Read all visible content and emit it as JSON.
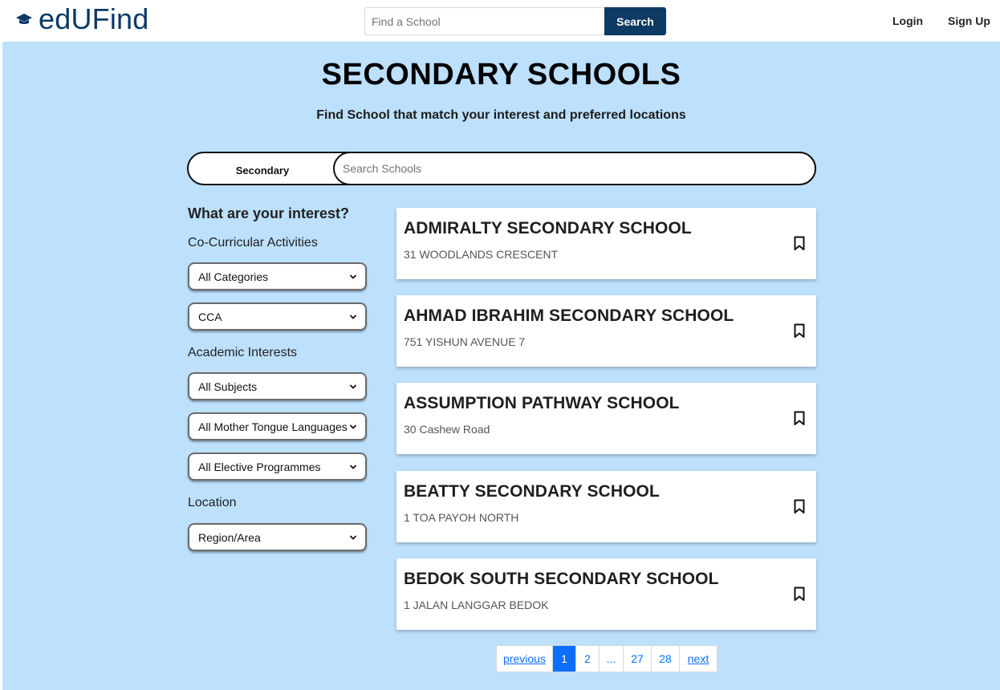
{
  "brand": {
    "name": "edUFind",
    "icon": "graduation-cap-icon"
  },
  "top_search": {
    "placeholder": "Find a School",
    "button_label": "Search"
  },
  "nav": {
    "login": "Login",
    "signup": "Sign Up"
  },
  "page": {
    "title": "SECONDARY SCHOOLS",
    "subtitle": "Find School that match your interest and preferred locations"
  },
  "school_search": {
    "level": "Secondary",
    "placeholder": "Search Schools"
  },
  "filters": {
    "heading": "What are your interest?",
    "cca_label": "Co-Curricular Activities",
    "cca_category": "All Categories",
    "cca": "CCA",
    "academic_label": "Academic Interests",
    "subjects": "All Subjects",
    "mother_tongue": "All Mother Tongue Languages",
    "electives": "All Elective Programmes",
    "location_label": "Location",
    "region": "Region/Area"
  },
  "schools": [
    {
      "name": "ADMIRALTY SECONDARY SCHOOL",
      "address": "31 WOODLANDS CRESCENT"
    },
    {
      "name": "AHMAD IBRAHIM SECONDARY SCHOOL",
      "address": "751 YISHUN AVENUE 7"
    },
    {
      "name": "ASSUMPTION PATHWAY SCHOOL",
      "address": "30 Cashew Road"
    },
    {
      "name": "BEATTY SECONDARY SCHOOL",
      "address": "1 TOA PAYOH NORTH"
    },
    {
      "name": "BEDOK SOUTH SECONDARY SCHOOL",
      "address": "1 JALAN LANGGAR BEDOK"
    }
  ],
  "pagination": {
    "previous": "previous",
    "pages": [
      "1",
      "2",
      "...",
      "27",
      "28"
    ],
    "active_page": "1",
    "next": "next"
  },
  "colors": {
    "brand": "#0b3a66",
    "search_button": "#0c3a63",
    "background": "#bde0fd",
    "pagination_active": "#0d6efd"
  }
}
